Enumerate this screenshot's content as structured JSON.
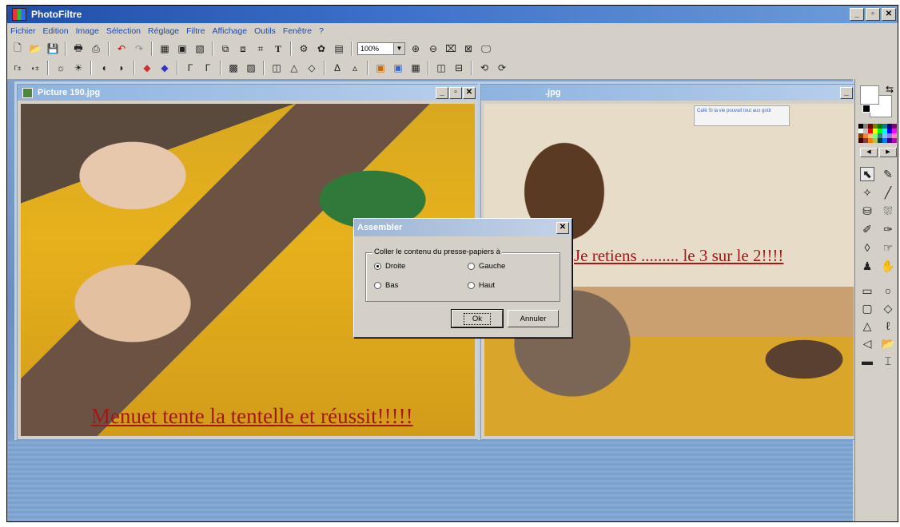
{
  "app": {
    "title": "PhotoFiltre"
  },
  "menu": [
    "Fichier",
    "Edition",
    "Image",
    "Sélection",
    "Réglage",
    "Filtre",
    "Affichage",
    "Outils",
    "Fenêtre",
    "?"
  ],
  "toolbar": {
    "zoom": "100%"
  },
  "documents": [
    {
      "title": "Picture 190.jpg",
      "caption": "Menuet tente la tentelle et réussit!!!!!"
    },
    {
      "title": ".jpg",
      "caption": "Je retiens ......... le 3 sur le 2!!!!"
    }
  ],
  "poster_text": "Café  Si la vie pouvait tout aux goût",
  "dialog": {
    "title": "Assembler",
    "group_label": "Coller le contenu du presse-papiers à",
    "options": [
      "Droite",
      "Gauche",
      "Bas",
      "Haut"
    ],
    "selected": "Droite",
    "ok": "Ok",
    "cancel": "Annuler"
  },
  "icons": {
    "window_controls": [
      "minimize-icon",
      "maximize-icon",
      "close-icon"
    ],
    "palette_colors": [
      "#000000",
      "#808080",
      "#800000",
      "#808000",
      "#008000",
      "#008080",
      "#000080",
      "#800080",
      "#ffffff",
      "#c0c0c0",
      "#ff0000",
      "#ffff00",
      "#00ff00",
      "#00ffff",
      "#0000ff",
      "#ff00ff",
      "#804000",
      "#ff8040",
      "#ffc080",
      "#80ff80",
      "#408080",
      "#80c0ff",
      "#8080ff",
      "#ff80c0",
      "#400000",
      "#804040",
      "#ff8000",
      "#c0c040",
      "#004040",
      "#0080ff",
      "#400080",
      "#c000c0"
    ]
  }
}
